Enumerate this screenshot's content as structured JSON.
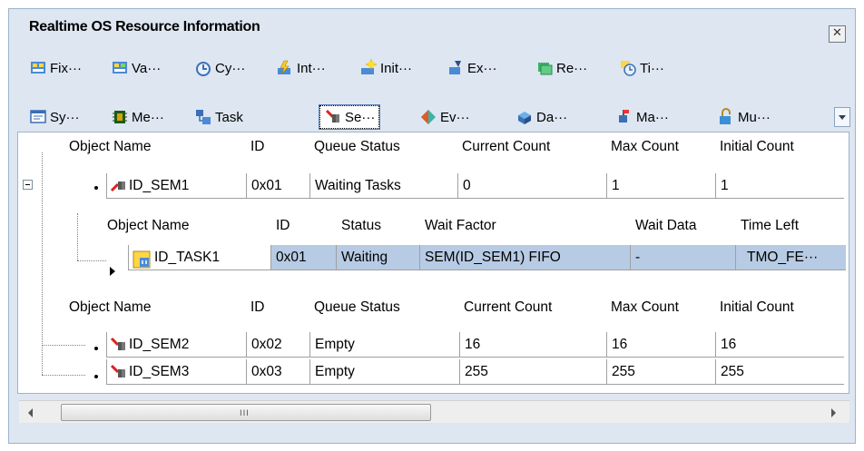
{
  "window": {
    "title": "Realtime OS Resource Information",
    "close_glyph": "✕"
  },
  "toolbar": {
    "row1": [
      {
        "label": "Fix···",
        "icon": "fixed-memory-icon"
      },
      {
        "label": "Va···",
        "icon": "variable-memory-icon"
      },
      {
        "label": "Cy···",
        "icon": "cyclic-handler-icon"
      },
      {
        "label": "Int···",
        "icon": "interrupt-handler-icon"
      },
      {
        "label": "Init···",
        "icon": "init-routine-icon"
      },
      {
        "label": "Ex···",
        "icon": "exception-icon"
      },
      {
        "label": "Re···",
        "icon": "ready-queue-icon"
      },
      {
        "label": "Ti···",
        "icon": "timer-icon"
      }
    ],
    "row2": [
      {
        "label": "Sy···",
        "icon": "system-state-icon"
      },
      {
        "label": "Me···",
        "icon": "memory-icon"
      },
      {
        "label": "Task",
        "icon": "task-icon"
      },
      {
        "label": "Se···",
        "icon": "semaphore-icon",
        "active": true
      },
      {
        "label": "Ev···",
        "icon": "eventflag-icon"
      },
      {
        "label": "Da···",
        "icon": "dataqueue-icon"
      },
      {
        "label": "Ma···",
        "icon": "mailbox-icon"
      },
      {
        "label": "Mu···",
        "icon": "mutex-icon"
      }
    ]
  },
  "semaphore_table": {
    "headers": [
      "Object Name",
      "ID",
      "Queue Status",
      "Current Count",
      "Max Count",
      "Initial Count"
    ],
    "rows": [
      {
        "name": "ID_SEM1",
        "id": "0x01",
        "queue_status": "Waiting Tasks",
        "current": "0",
        "max": "1",
        "initial": "1"
      }
    ]
  },
  "wait_table": {
    "headers": [
      "Object Name",
      "ID",
      "Status",
      "Wait Factor",
      "Wait Data",
      "Time Left"
    ],
    "rows": [
      {
        "name": "ID_TASK1",
        "id": "0x01",
        "status": "Waiting",
        "wait_factor": "SEM(ID_SEM1) FIFO",
        "wait_data": "-",
        "time_left": "TMO_FE···"
      }
    ]
  },
  "semaphore_table2": {
    "headers": [
      "Object Name",
      "ID",
      "Queue Status",
      "Current Count",
      "Max Count",
      "Initial Count"
    ],
    "rows": [
      {
        "name": "ID_SEM2",
        "id": "0x02",
        "queue_status": "Empty",
        "current": "16",
        "max": "16",
        "initial": "16"
      },
      {
        "name": "ID_SEM3",
        "id": "0x03",
        "queue_status": "Empty",
        "current": "255",
        "max": "255",
        "initial": "255"
      }
    ]
  },
  "scrollbar": {
    "grip": "III"
  },
  "colors": {
    "panel": "#dde6f1",
    "selection": "#b8cbe4",
    "border": "#9fb3cc"
  }
}
